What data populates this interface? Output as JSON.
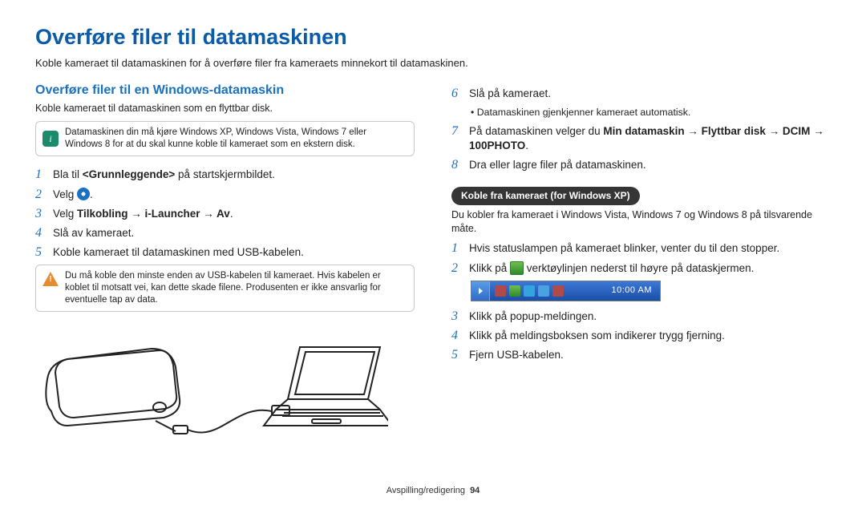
{
  "title": "Overføre filer til datamaskinen",
  "intro": "Koble kameraet til datamaskinen for å overføre filer fra kameraets minnekort til datamaskinen.",
  "left": {
    "subtitle": "Overføre filer til en Windows-datamaskin",
    "lead": "Koble kameraet til datamaskinen som en flyttbar disk.",
    "info_note": "Datamaskinen din må kjøre Windows XP, Windows Vista, Windows 7 eller Windows 8 for at du skal kunne koble til kameraet som en ekstern disk.",
    "steps": [
      {
        "n": "1",
        "pre": "Bla til ",
        "bold": "<Grunnleggende>",
        "post": " på startskjermbildet."
      },
      {
        "n": "2",
        "pre": "Velg ",
        "icon": "blue-dot",
        "post": "."
      },
      {
        "n": "3",
        "pre": "Velg ",
        "bold": "Tilkobling → i-Launcher → Av",
        "post": "."
      },
      {
        "n": "4",
        "text": "Slå av kameraet."
      },
      {
        "n": "5",
        "text": "Koble kameraet til datamaskinen med USB-kabelen."
      }
    ],
    "warn_note": "Du må koble den minste enden av USB-kabelen til kameraet. Hvis kabelen er koblet til motsatt vei, kan dette skade filene. Produsenten er ikke ansvarlig for eventuelle tap av data."
  },
  "right": {
    "steps_top": [
      {
        "n": "6",
        "text": "Slå på kameraet.",
        "sub": "Datamaskinen gjenkjenner kameraet automatisk."
      },
      {
        "n": "7",
        "pre": "På datamaskinen velger du ",
        "bold": "Min datamaskin → Flyttbar disk → DCIM → 100PHOTO",
        "post": "."
      },
      {
        "n": "8",
        "text": "Dra eller lagre filer på datamaskinen."
      }
    ],
    "pill": "Koble fra kameraet (for Windows XP)",
    "pill_lead": "Du kobler fra kameraet i Windows Vista, Windows 7 og Windows 8 på tilsvarende måte.",
    "steps_bottom": [
      {
        "n": "1",
        "text": "Hvis statuslampen på kameraet blinker, venter du til den stopper."
      },
      {
        "n": "2",
        "pre": "Klikk på ",
        "icon": "tray",
        "post": " verktøylinjen nederst til høyre på dataskjermen."
      },
      {
        "n": "3",
        "text": "Klikk på popup-meldingen."
      },
      {
        "n": "4",
        "text": "Klikk på meldingsboksen som indikerer trygg fjerning."
      },
      {
        "n": "5",
        "text": "Fjern USB-kabelen."
      }
    ],
    "taskbar_time": "10:00 AM"
  },
  "footer": {
    "section": "Avspilling/redigering",
    "page": "94"
  }
}
